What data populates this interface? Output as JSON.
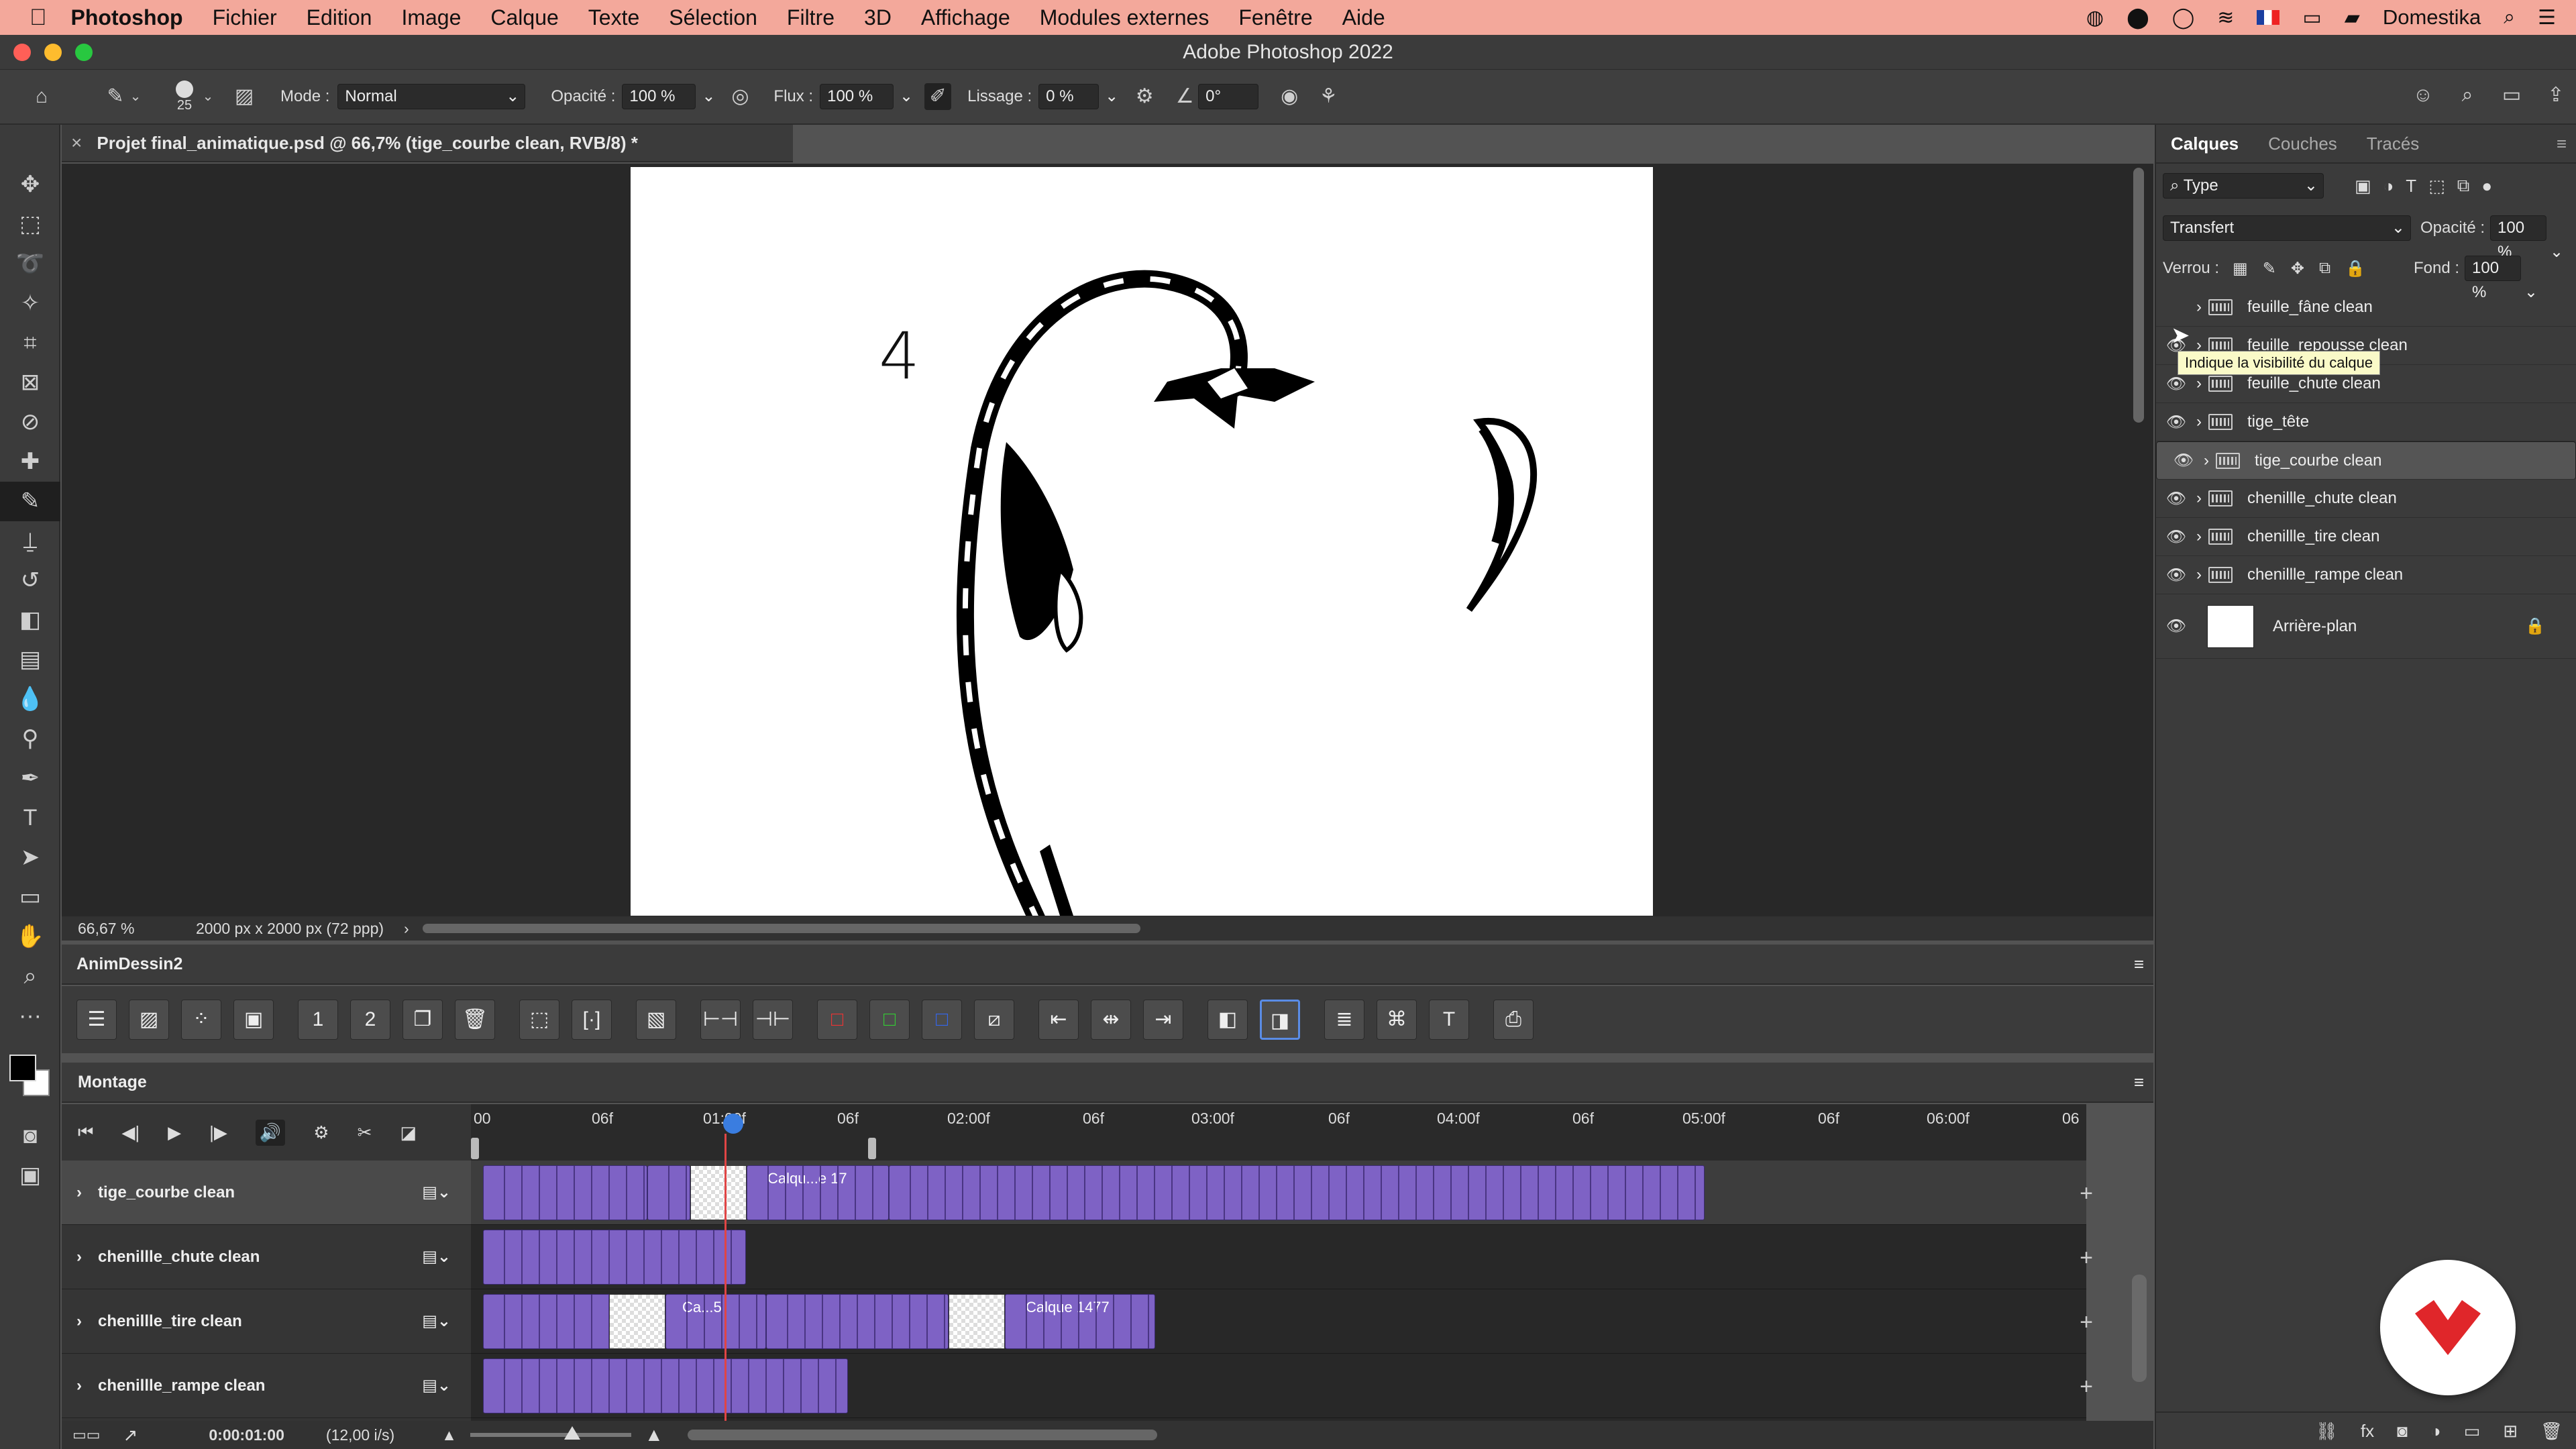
{
  "menubar": {
    "app": "Photoshop",
    "items": [
      "Fichier",
      "Edition",
      "Image",
      "Calque",
      "Texte",
      "Sélection",
      "Filtre",
      "3D",
      "Affichage",
      "Modules externes",
      "Fenêtre",
      "Aide"
    ],
    "right_user": "Domestika"
  },
  "window": {
    "title": "Adobe Photoshop 2022"
  },
  "options": {
    "brush_size": "25",
    "mode_label": "Mode :",
    "mode_value": "Normal",
    "opacity_label": "Opacité :",
    "opacity_value": "100 %",
    "flux_label": "Flux :",
    "flux_value": "100 %",
    "smoothing_label": "Lissage :",
    "smoothing_value": "0 %",
    "angle_value": "0°"
  },
  "document": {
    "tab_title": "Projet final_animatique.psd @ 66,7% (tige_courbe clean, RVB/8) *",
    "zoom": "66,67 %",
    "size": "2000 px x 2000 px (72 ppp)",
    "canvas_number": "4"
  },
  "anim_panel": {
    "title": "AnimDessin2"
  },
  "timeline": {
    "title": "Montage",
    "ruler": [
      "00",
      "06f",
      "01:00f",
      "06f",
      "02:00f",
      "06f",
      "03:00f",
      "06f",
      "04:00f",
      "06f",
      "05:00f",
      "06f",
      "06:00f",
      "06"
    ],
    "tracks": [
      {
        "name": "tige_courbe clean",
        "caption": "Calqu...e 17"
      },
      {
        "name": "chenillle_chute clean",
        "caption": ""
      },
      {
        "name": "chenillle_tire clean",
        "caption": "Ca...5",
        "caption2": "Calque 1477"
      },
      {
        "name": "chenillle_rampe clean",
        "caption": ""
      }
    ],
    "time": "0:00:01:00",
    "fps": "(12,00 i/s)"
  },
  "layers_panel": {
    "tabs": [
      "Calques",
      "Couches",
      "Tracés"
    ],
    "filter": "Type",
    "blend_mode": "Transfert",
    "opacity_label": "Opacité :",
    "opacity_value": "100 %",
    "lock_label": "Verrou :",
    "fill_label": "Fond :",
    "fill_value": "100 %",
    "tooltip": "Indique la visibilité du calque",
    "layers": [
      "feuille_fâne clean",
      "feuille_repousse clean",
      "feuille_chute clean",
      "tige_tête",
      "tige_courbe clean",
      "chenillle_chute clean",
      "chenillle_tire clean",
      "chenillle_rampe clean"
    ],
    "background": "Arrière-plan"
  },
  "colors": {
    "accent": "#7e62c5",
    "logo_red": "#e0262a",
    "menubar": "#f3a89b"
  }
}
